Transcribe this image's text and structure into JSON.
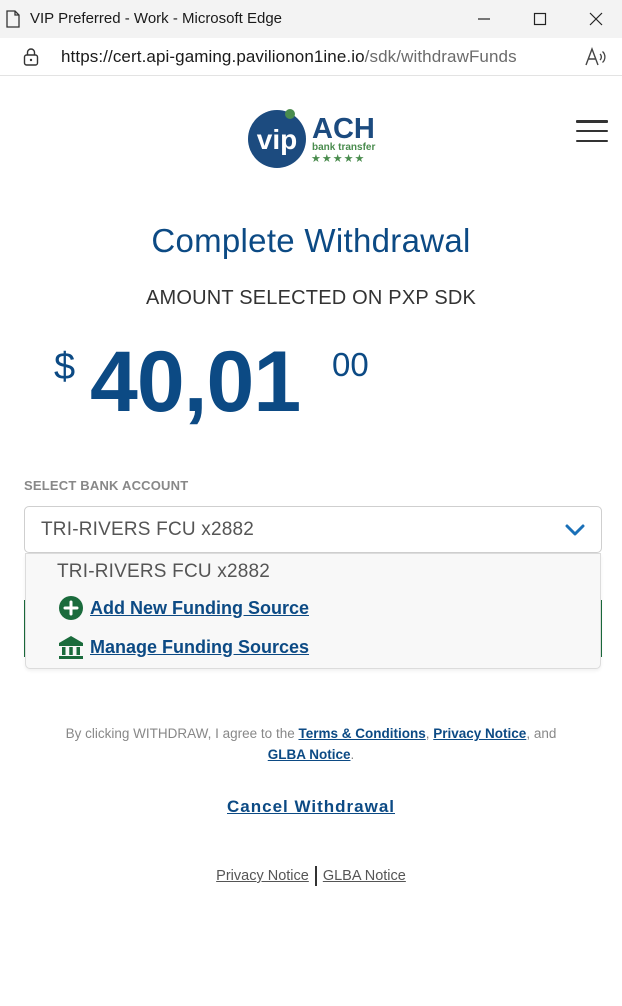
{
  "browser": {
    "window_title": "VIP Preferred - Work - Microsoft Edge",
    "url_host": "https://cert.api-gaming.pavilionon1ine.io",
    "url_path": "/sdk/withdrawFunds"
  },
  "logo": {
    "vip": "vip",
    "ach": "ACH",
    "tagline": "bank transfer",
    "stars": "★★★★★",
    "colors": {
      "navy": "#1c4b7f",
      "green": "#4a8c4e"
    }
  },
  "page": {
    "heading": "Complete Withdrawal",
    "subheading": "AMOUNT SELECTED ON PXP SDK",
    "amount": {
      "currency": "$",
      "whole": "40,01",
      "cents": "00"
    }
  },
  "bank_select": {
    "label": "SELECT BANK ACCOUNT",
    "selected": "TRI-RIVERS FCU x2882",
    "options": [
      {
        "label": "TRI-RIVERS FCU x2882"
      },
      {
        "label": "Add New Funding Source",
        "icon": "plus-circle-icon"
      },
      {
        "label": "Manage Funding Sources",
        "icon": "bank-icon"
      }
    ]
  },
  "legal": {
    "prefix": "By clicking WITHDRAW, I agree to the ",
    "terms": "Terms & Conditions",
    "comma": ", ",
    "privacy": "Privacy Notice",
    "and": ", and",
    "glba": "GLBA Notice",
    "period": "."
  },
  "cancel_label": "Cancel Withdrawal",
  "footer": {
    "privacy": "Privacy Notice",
    "glba": "GLBA Notice"
  },
  "colors": {
    "primary": "#0c4a84",
    "accent_green": "#1a6b3c"
  }
}
